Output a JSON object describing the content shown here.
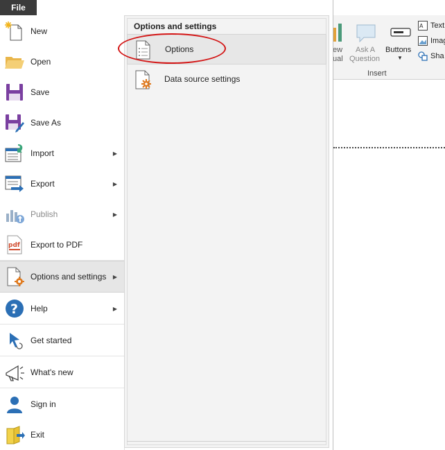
{
  "file_tab": "File",
  "menu": [
    {
      "label": "New",
      "icon": "new-icon",
      "arrow": false,
      "disabled": false
    },
    {
      "label": "Open",
      "icon": "folder-open-icon",
      "arrow": false,
      "disabled": false
    },
    {
      "label": "Save",
      "icon": "save-icon",
      "arrow": false,
      "disabled": false
    },
    {
      "label": "Save As",
      "icon": "save-as-icon",
      "arrow": false,
      "disabled": false
    },
    {
      "label": "Import",
      "icon": "import-icon",
      "arrow": true,
      "disabled": false
    },
    {
      "label": "Export",
      "icon": "export-icon",
      "arrow": true,
      "disabled": false
    },
    {
      "label": "Publish",
      "icon": "publish-icon",
      "arrow": true,
      "disabled": true
    },
    {
      "label": "Export to PDF",
      "icon": "pdf-icon",
      "arrow": false,
      "disabled": false
    },
    {
      "label": "Options and settings",
      "icon": "options-settings-icon",
      "arrow": true,
      "disabled": false,
      "selected": true
    },
    {
      "label": "Help",
      "icon": "help-icon",
      "arrow": true,
      "disabled": false
    },
    {
      "label": "Get started",
      "icon": "get-started-icon",
      "arrow": false,
      "disabled": false
    },
    {
      "label": "What's new",
      "icon": "megaphone-icon",
      "arrow": false,
      "disabled": false
    },
    {
      "label": "Sign in",
      "icon": "user-icon",
      "arrow": false,
      "disabled": false
    },
    {
      "label": "Exit",
      "icon": "exit-icon",
      "arrow": false,
      "disabled": false
    }
  ],
  "submenu": {
    "title": "Options and settings",
    "items": [
      {
        "label": "Options",
        "icon": "options-document-icon"
      },
      {
        "label": "Data source settings",
        "icon": "data-source-settings-icon"
      }
    ]
  },
  "ribbon": {
    "new_visual": "ew",
    "new_visual2": "ual",
    "ask_question": "Ask A",
    "ask_question2": "Question",
    "buttons": "Buttons",
    "text": "Text",
    "image": "Imag",
    "shapes": "Sha",
    "group_label": "Insert"
  },
  "colors": {
    "accent_circle": "#d31414",
    "file_tab_bg": "#3b3b3b",
    "settings_gear": "#e07b20",
    "help_blue": "#2b6fb5"
  }
}
